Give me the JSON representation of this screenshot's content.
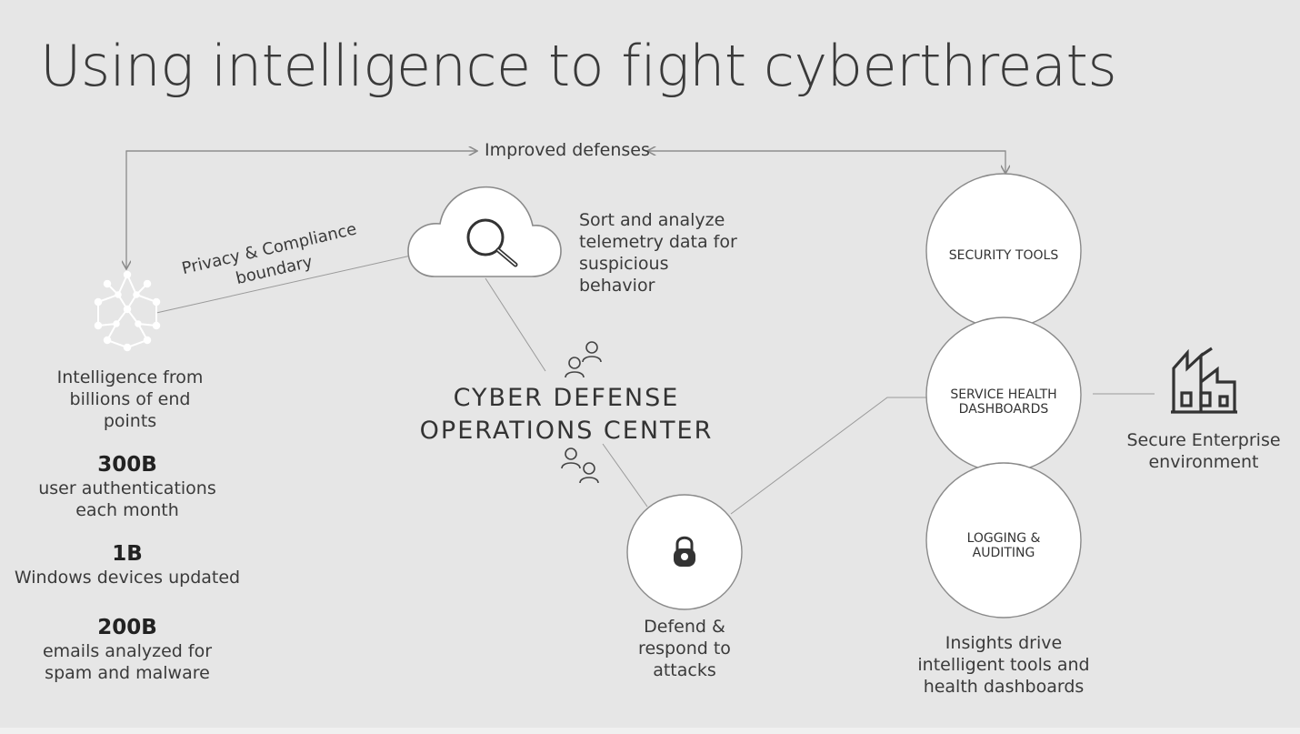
{
  "title": "Using intelligence to fight cyberthreats",
  "feedback": {
    "label": "Improved defenses"
  },
  "boundary": {
    "label": "Privacy & Compliance boundary"
  },
  "cloud": {
    "description": "Sort and analyze telemetry data for suspicious behavior"
  },
  "center": {
    "line1": "CYBER DEFENSE",
    "line2": "OPERATIONS CENTER"
  },
  "intelligence": {
    "description": "Intelligence from billions of end points"
  },
  "stats": [
    {
      "value": "300B",
      "label": "user authentications each month"
    },
    {
      "value": "1B",
      "label": "Windows devices updated"
    },
    {
      "value": "200B",
      "label": "emails analyzed for spam and malware"
    }
  ],
  "defend": {
    "label": "Defend & respond to attacks"
  },
  "circles": [
    {
      "label": "SECURITY TOOLS"
    },
    {
      "label": "SERVICE HEALTH DASHBOARDS"
    },
    {
      "label": "LOGGING & AUDITING"
    }
  ],
  "insights": {
    "label": "Insights drive intelligent tools and health dashboards"
  },
  "enterprise": {
    "label": "Secure Enterprise environment"
  },
  "icons": [
    "network-nodes-icon",
    "magnifier-icon",
    "cloud-icon",
    "people-icon",
    "lock-icon",
    "factory-icon"
  ],
  "colors": {
    "background": "#e6e6e6",
    "line": "#8a8a8a",
    "circle_fill": "#ffffff",
    "text": "#333333"
  }
}
